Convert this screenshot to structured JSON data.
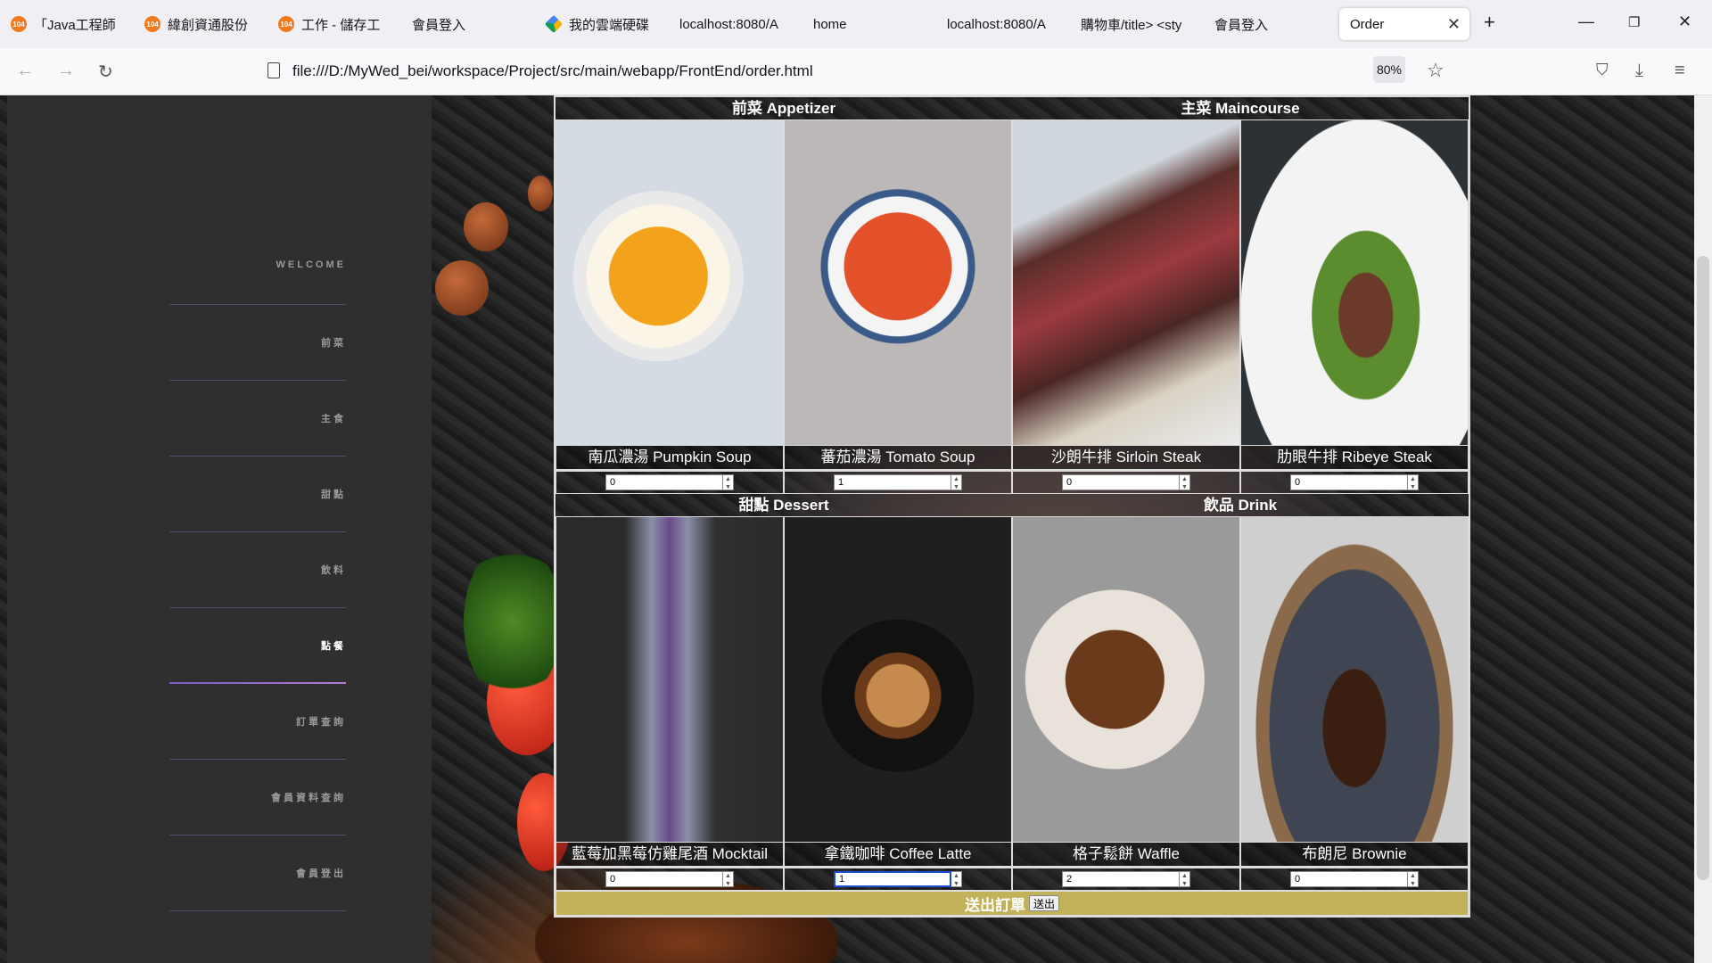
{
  "browser": {
    "tabs": [
      {
        "label": "「Java工程師",
        "icon": "orange-104-icon"
      },
      {
        "label": "緯創資通股份",
        "icon": "orange-104-icon"
      },
      {
        "label": "工作 - 儲存工",
        "icon": "orange-104-icon"
      },
      {
        "label": "會員登入",
        "icon": ""
      },
      {
        "label": "我的雲端硬碟",
        "icon": "google-drive-icon"
      },
      {
        "label": "localhost:8080/A",
        "icon": ""
      },
      {
        "label": "home",
        "icon": ""
      },
      {
        "label": "localhost:8080/A",
        "icon": ""
      },
      {
        "label": "購物車/title> <sty",
        "icon": ""
      },
      {
        "label": "會員登入",
        "icon": ""
      }
    ],
    "active_tab": "Order",
    "url": "file:///D:/MyWed_bei/workspace/Project/src/main/webapp/FrontEnd/order.html",
    "zoom": "80%"
  },
  "sidebar": {
    "items": [
      {
        "label": "WELCOME",
        "active": false
      },
      {
        "label": "前菜",
        "active": false
      },
      {
        "label": "主食",
        "active": false
      },
      {
        "label": "甜點",
        "active": false
      },
      {
        "label": "飲料",
        "active": false
      },
      {
        "label": "點餐",
        "active": true
      },
      {
        "label": "訂單查詢",
        "active": false
      },
      {
        "label": "會員資料查詢",
        "active": false
      },
      {
        "label": "會員登出",
        "active": false
      }
    ]
  },
  "order": {
    "sections_top": [
      "前菜 Appetizer",
      "主菜 Maincourse"
    ],
    "sections_bottom": [
      "甜點 Dessert",
      "飲品 Drink"
    ],
    "items_top": [
      {
        "name": "南瓜濃湯 Pumpkin Soup",
        "qty": "0"
      },
      {
        "name": "蕃茄濃湯 Tomato Soup",
        "qty": "1"
      },
      {
        "name": "沙朗牛排 Sirloin Steak",
        "qty": "0"
      },
      {
        "name": "肋眼牛排 Ribeye Steak",
        "qty": "0"
      }
    ],
    "items_bottom": [
      {
        "name": "藍莓加黑莓仿雞尾酒 Mocktail",
        "qty": "0"
      },
      {
        "name": "拿鐵咖啡 Coffee Latte",
        "qty": "1"
      },
      {
        "name": "格子鬆餅 Waffle",
        "qty": "2"
      },
      {
        "name": "布朗尼 Brownie",
        "qty": "0"
      }
    ],
    "submit_label": "送出訂單",
    "submit_button": "送出"
  },
  "colors": {
    "submit_bar": "#c1b25a",
    "sidebar_bg": "#2f2f2f",
    "active_line": "#9b6bd0"
  }
}
